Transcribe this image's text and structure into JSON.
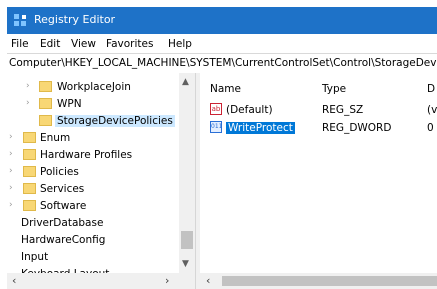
{
  "window": {
    "title": "Registry Editor",
    "app_icon": "registry-editor-icon"
  },
  "menu": {
    "items": [
      "File",
      "Edit",
      "View",
      "Favorites",
      "Help"
    ]
  },
  "address": {
    "path": "Computer\\HKEY_LOCAL_MACHINE\\SYSTEM\\CurrentControlSet\\Control\\StorageDevicePolicies"
  },
  "tree": {
    "items": [
      {
        "label": "WorkplaceJoin"
      },
      {
        "label": "WPN"
      },
      {
        "label": "StorageDevicePolicies"
      },
      {
        "label": "Enum"
      },
      {
        "label": "Hardware Profiles"
      },
      {
        "label": "Policies"
      },
      {
        "label": "Services"
      },
      {
        "label": "Software"
      },
      {
        "label": "DriverDatabase"
      },
      {
        "label": "HardwareConfig"
      },
      {
        "label": "Input"
      },
      {
        "label": "Keyboard Layout"
      }
    ]
  },
  "list": {
    "columns": {
      "name": "Name",
      "type": "Type",
      "data": "D"
    },
    "rows": [
      {
        "name": "(Default)",
        "type": "REG_SZ",
        "data": "(v",
        "icon": "string-value-icon"
      },
      {
        "name": "WriteProtect",
        "type": "REG_DWORD",
        "data": "0",
        "icon": "binary-value-icon"
      }
    ]
  },
  "icons": {
    "ab_glyph": "ab",
    "bin_glyph": "011"
  }
}
